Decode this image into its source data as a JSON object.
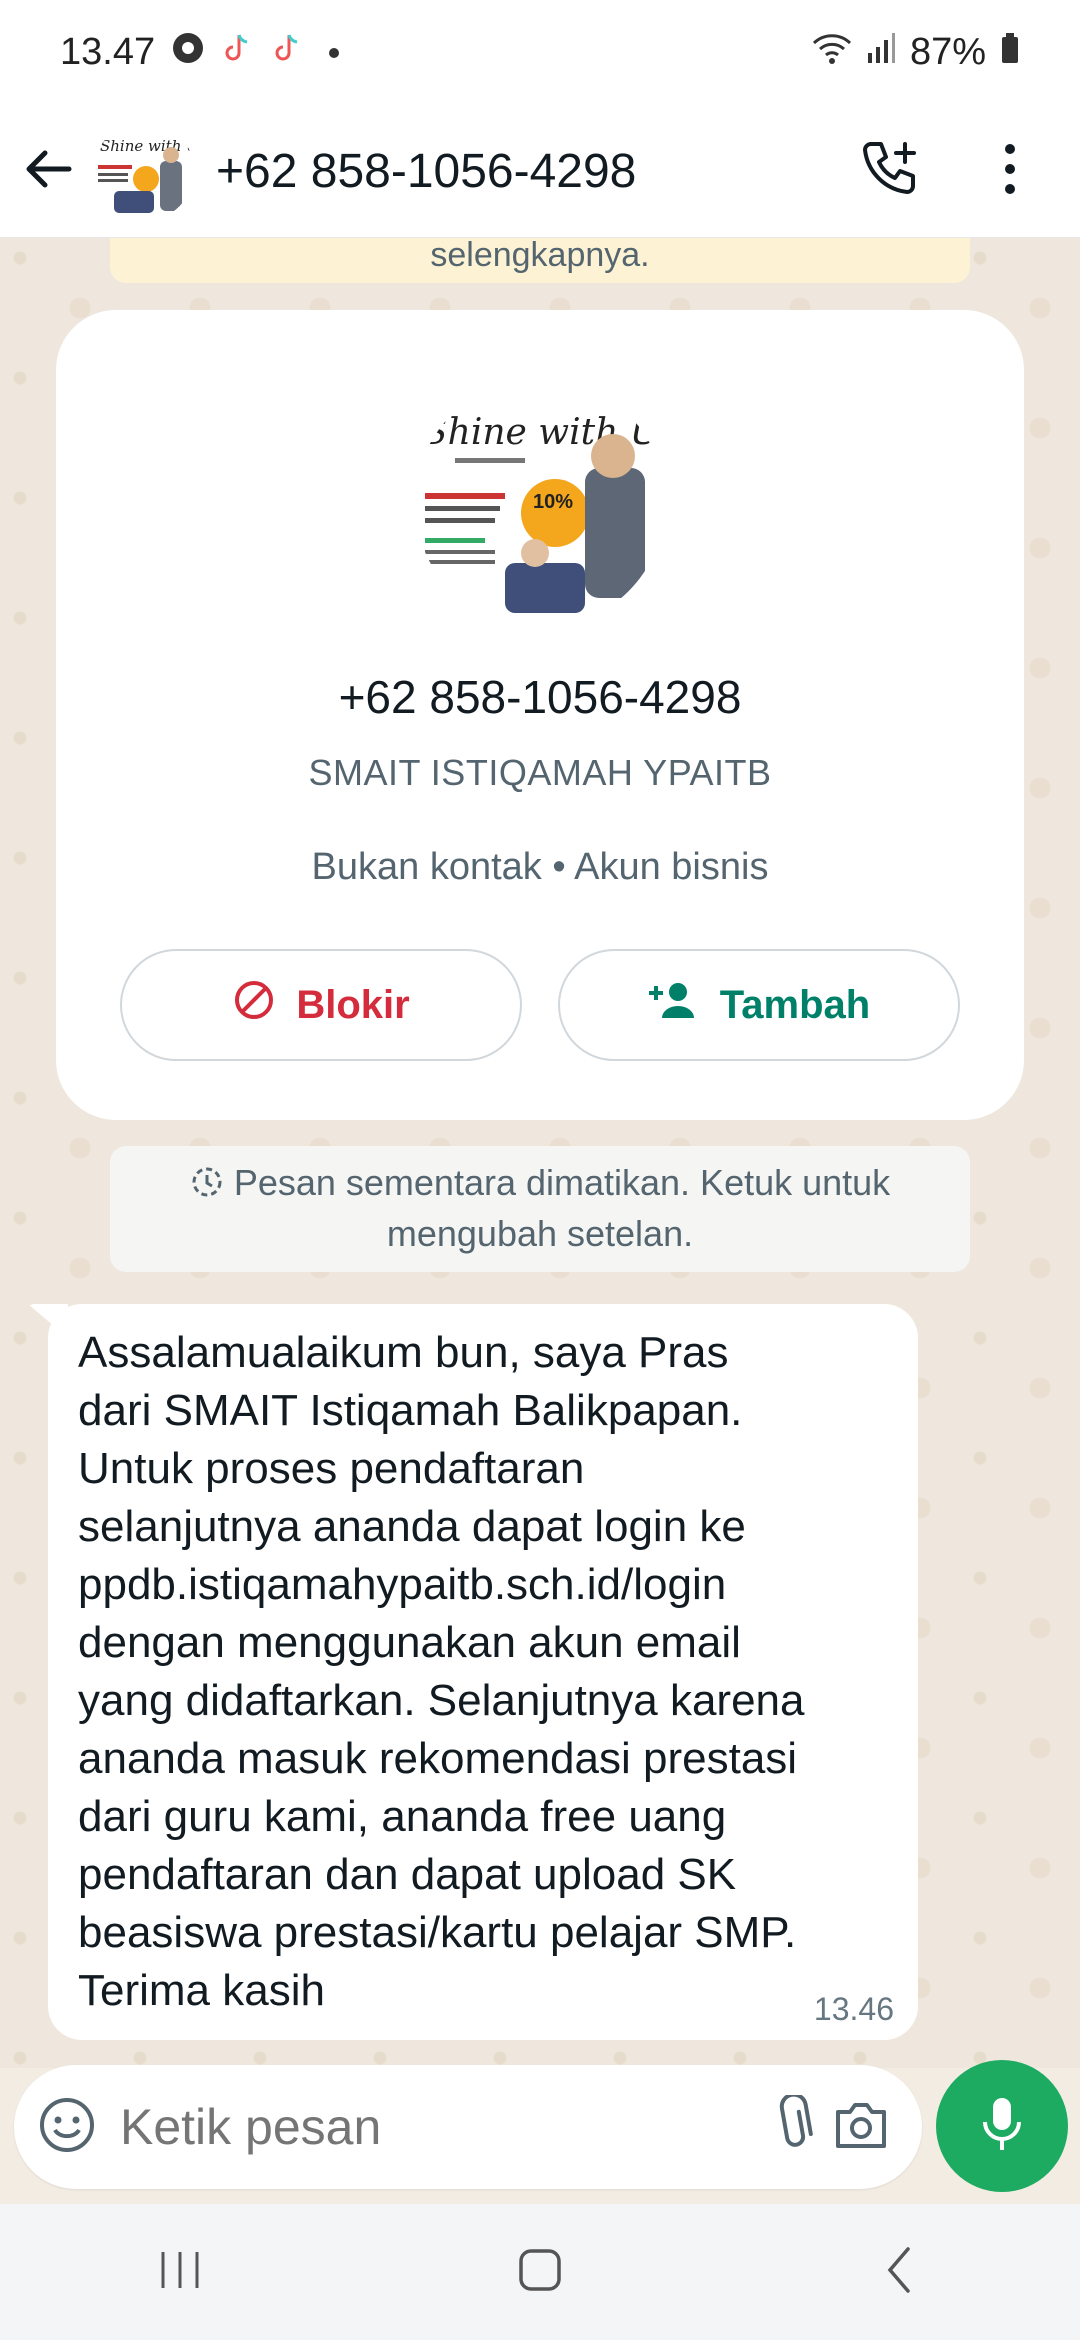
{
  "status_bar": {
    "time": "13.47",
    "battery": "87%",
    "icons": [
      "chrome-icon",
      "tiktok-icon",
      "tiktok-icon",
      "notification-dot"
    ],
    "right_icons": [
      "wifi-icon",
      "signal-icon",
      "battery-icon"
    ]
  },
  "header": {
    "title": "+62 858-1056-4298",
    "avatar_text": "Shine with Us",
    "back_icon": "arrow-left-icon",
    "call_icon": "add-call-icon",
    "menu_icon": "more-vert-icon"
  },
  "chat": {
    "top_notice": "selengkapnya.",
    "profile": {
      "avatar_text": "Shine with Us",
      "avatar_badge": "10%",
      "phone": "+62 858-1056-4298",
      "business_name": "SMAIT ISTIQAMAH YPAITB",
      "meta": "Bukan kontak • Akun bisnis",
      "block_label": "Blokir",
      "add_label": "Tambah"
    },
    "system_note": "Pesan sementara dimatikan. Ketuk untuk mengubah setelan.",
    "message": {
      "text": "Assalamualaikum bun, saya Pras\ndari SMAIT Istiqamah Balikpapan.\nUntuk proses pendaftaran\nselanjutnya ananda dapat login ke\nppdb.istiqamahypaitb.sch.id/login\ndengan menggunakan akun email\nyang didaftarkan. Selanjutnya karena\nananda masuk rekomendasi prestasi\ndari guru kami, ananda free uang\npendaftaran dan dapat upload SK\nbeasiswa prestasi/kartu pelajar SMP.\nTerima kasih",
      "time": "13.46"
    }
  },
  "composer": {
    "placeholder": "Ketik pesan",
    "emoji_icon": "emoji-icon",
    "attach_icon": "paperclip-icon",
    "camera_icon": "camera-icon",
    "mic_icon": "mic-icon"
  },
  "colors": {
    "accent_green": "#008069",
    "mic_green": "#1daa61",
    "block_red": "#d42c3c",
    "chat_bg": "#efe7dd"
  }
}
